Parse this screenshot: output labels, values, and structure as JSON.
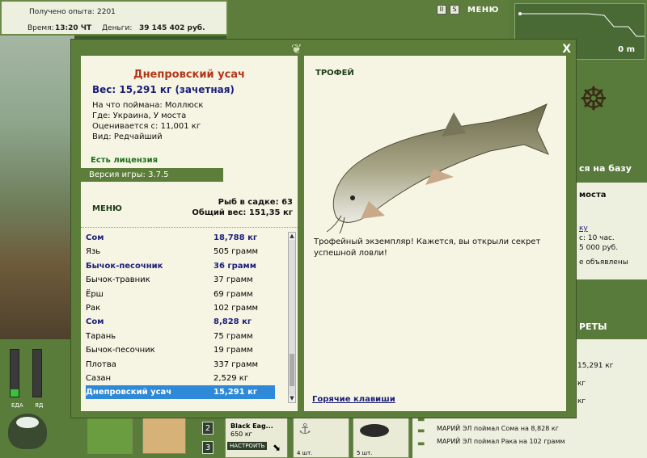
{
  "topbar": {
    "exp_label": "Получено опыта:",
    "exp_value": "2201",
    "time_label": "Время:",
    "time_value": "13:20 ЧТ",
    "money_label": "Деньги:",
    "money_value": "39 145 402 руб."
  },
  "top_icons": {
    "pause": "II",
    "sound": "S",
    "menu": "МЕНЮ"
  },
  "depth": {
    "value": "0 m"
  },
  "dialog": {
    "close": "X",
    "fish_name": "Днепровский усач",
    "weight": "Вес: 15,291 кг (зачетная)",
    "info": [
      "На что поймана: Моллюск",
      "Где: Украина, У моста",
      "Оценивается с: 11,001 кг",
      "Вид: Редчайший"
    ],
    "license": "Есть лицензия",
    "version": "Версия игры: 3.7.5",
    "menu": "МЕНЮ",
    "keep_count": "Рыб в садке: 63",
    "keep_weight": "Общий вес: 151,35 кг",
    "catches": [
      {
        "name": "Сом",
        "weight": "18,788 кг",
        "bold": true
      },
      {
        "name": "Язь",
        "weight": "505 грамм",
        "bold": false
      },
      {
        "name": "Бычок-песочник",
        "weight": "36 грамм",
        "bold": true
      },
      {
        "name": "Бычок-травник",
        "weight": "37 грамм",
        "bold": false
      },
      {
        "name": "Ёрш",
        "weight": "69 грамм",
        "bold": false
      },
      {
        "name": "Рак",
        "weight": "102 грамм",
        "bold": false
      },
      {
        "name": "Сом",
        "weight": "8,828 кг",
        "bold": true
      },
      {
        "name": "Тарань",
        "weight": "75 грамм",
        "bold": false
      },
      {
        "name": "Бычок-песочник",
        "weight": "19 грамм",
        "bold": false
      },
      {
        "name": "Плотва",
        "weight": "337 грамм",
        "bold": false
      },
      {
        "name": "Сазан",
        "weight": "2,529 кг",
        "bold": false
      },
      {
        "name": "Днепровский усач",
        "weight": "15,291 кг",
        "bold": false,
        "selected": true
      }
    ],
    "trophy_title": "ТРОФЕЙ",
    "trophy_text": "Трофейный экземпляр! Кажется, вы открыли секрет успешной ловли!",
    "hotkeys": "Горячие клавиши"
  },
  "right_panel": {
    "base": "ся на базу",
    "place": "моста",
    "link": "ку",
    "l1": "с: 10 час.",
    "l2": "5 000 руб.",
    "l3": "е объявлены",
    "secrets": "РЕТЫ",
    "w1": "15,291 кг",
    "w2": "кг",
    "w3": "кг"
  },
  "news": [
    "МАРИЙ ЭЛ поймал Сома на 8,828 кг",
    "МАРИЙ ЭЛ поймал Рака на 102 грамм"
  ],
  "bottom": {
    "food_label": "ЕДА",
    "poison_label": "ЯД",
    "food_level": 0.15,
    "slot2": "2",
    "slot3": "3",
    "bait_name": "Black Eag...",
    "bait_weight": "650 кг",
    "configure": "НАСТРОИТЬ",
    "count1": "4 шт.",
    "count2": "5 шт."
  }
}
